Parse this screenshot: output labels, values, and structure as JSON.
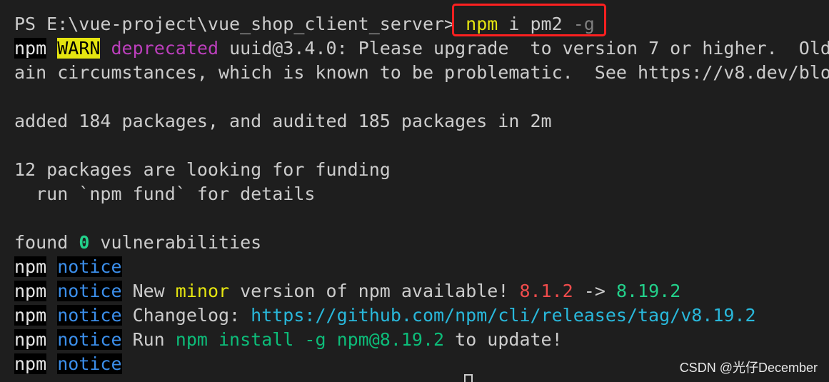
{
  "prompt": {
    "path": "PS E:\\vue-project\\vue_shop_client_server>",
    "command_name": "npm",
    "command_args": "i pm2",
    "command_flag": "-g"
  },
  "warn_line": {
    "prefix": "npm",
    "badge": "WARN",
    "status": "deprecated",
    "message": "uuid@3.4.0: Please upgrade  to version 7 or higher.  Old",
    "continuation": "ain circumstances, which is known to be problematic.  See https://v8.dev/blo"
  },
  "summary": {
    "added": "added 184 packages, and audited 185 packages in 2m",
    "funding_line1": "12 packages are looking for funding",
    "funding_line2": "  run `npm fund` for details",
    "vuln_prefix": "found ",
    "vuln_count": "0",
    "vuln_suffix": " vulnerabilities"
  },
  "notices": {
    "prefix": "npm",
    "label": "notice",
    "line2_a": " New ",
    "line2_minor": "minor",
    "line2_b": " version of npm available! ",
    "old_version": "8.1.2",
    "arrow": " -> ",
    "new_version": "8.19.2",
    "line3_a": " Changelog: ",
    "changelog_url": "https://github.com/npm/cli/releases/tag/v8.19.2",
    "line4_a": " Run ",
    "install_cmd": "npm install -g npm@8.19.2",
    "line4_b": " to update!"
  },
  "watermark": "CSDN @光仔December",
  "colors": {
    "background": "#1e1e1e",
    "foreground": "#cccccc",
    "warn_badge": "#e5e510",
    "deprecated": "#bc3fbc",
    "notice": "#3b8eea",
    "highlight_box": "#ff2020"
  }
}
